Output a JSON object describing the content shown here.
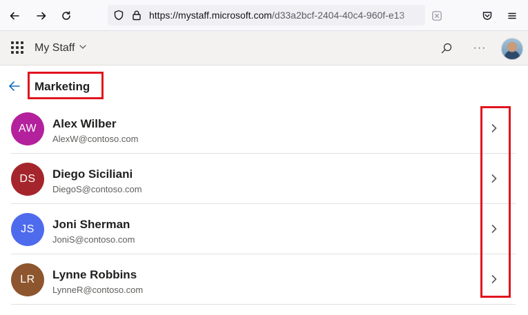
{
  "browser": {
    "url_prefix": "https://",
    "url_host": "mystaff.microsoft.com",
    "url_path": "/d33a2bcf-2404-40c4-960f-e13"
  },
  "app": {
    "title": "My Staff",
    "more": "···"
  },
  "page": {
    "title": "Marketing"
  },
  "people": [
    {
      "initials": "AW",
      "name": "Alex Wilber",
      "email": "AlexW@contoso.com",
      "color": "#b4219c"
    },
    {
      "initials": "DS",
      "name": "Diego Siciliani",
      "email": "DiegoS@contoso.com",
      "color": "#a4262c"
    },
    {
      "initials": "JS",
      "name": "Joni Sherman",
      "email": "JoniS@contoso.com",
      "color": "#4f6bed"
    },
    {
      "initials": "LR",
      "name": "Lynne Robbins",
      "email": "LynneR@contoso.com",
      "color": "#8e562e"
    }
  ],
  "colors": {
    "highlight": "#e0141e",
    "accent": "#0f6cbd"
  },
  "icons": {
    "back": "back-icon",
    "forward": "forward-icon",
    "reload": "reload-icon",
    "shield": "shield-icon",
    "lock": "lock-icon",
    "close_tab": "close-icon",
    "pocket": "pocket-icon",
    "menu": "menu-icon",
    "waffle": "app-launcher-icon",
    "search": "search-icon",
    "chevron": "chevron-right-icon"
  }
}
